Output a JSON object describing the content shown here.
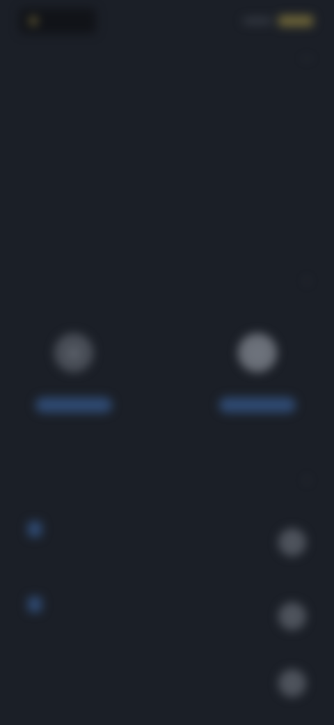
{
  "status_bar": {
    "left_text": "",
    "accent_color": "#6e6538"
  },
  "nav": {
    "title": "",
    "action_icon": "more-icon"
  },
  "content": {
    "headline": "",
    "paragraphs": [
      "",
      "",
      ""
    ],
    "paragraph_chevron_icon": "chevron-right-icon"
  },
  "profiles": [
    {
      "name": "",
      "button_label": "",
      "avatar_icon": "user-icon"
    },
    {
      "name": "",
      "button_label": "",
      "avatar_icon": "user-icon"
    }
  ],
  "section": {
    "heading": "",
    "chevron_icon": "chevron-right-icon"
  },
  "rows": [
    {
      "badge": "",
      "label": "",
      "meta": ""
    },
    {
      "badge": "",
      "label": "",
      "meta": ""
    },
    {
      "badge": "",
      "label": "",
      "meta": ""
    }
  ],
  "colors": {
    "background": "#1b1f27",
    "accent_blue": "#2f4a72",
    "accent_gold": "#6e6538"
  }
}
